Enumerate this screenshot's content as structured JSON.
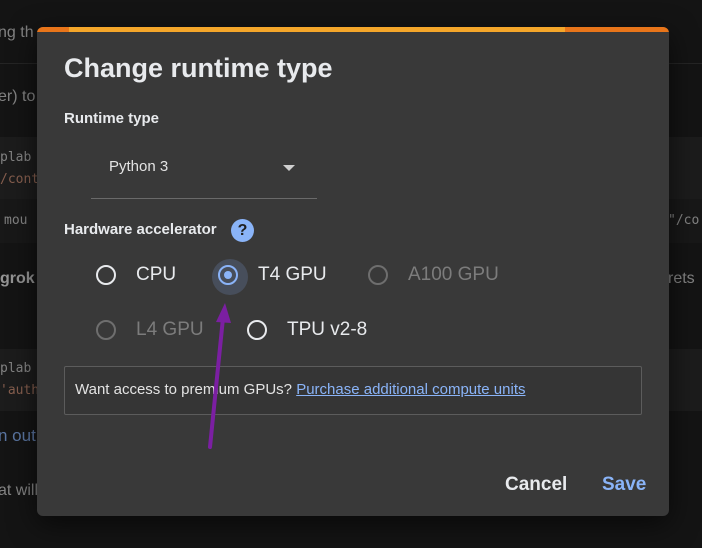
{
  "background": {
    "fragments": [
      "ng th",
      "er) to",
      "plab",
      "/cont",
      "mou",
      "\"/co",
      "grok",
      "rets",
      "plab",
      "'auth",
      "n out",
      "at will"
    ]
  },
  "dialog": {
    "title": "Change runtime type",
    "runtime_section_label": "Runtime type",
    "runtime_select_value": "Python 3",
    "hardware_section_label": "Hardware accelerator",
    "help_icon_glyph": "?",
    "accelerators": [
      {
        "label": "CPU",
        "state": "unselected"
      },
      {
        "label": "T4 GPU",
        "state": "selected"
      },
      {
        "label": "A100 GPU",
        "state": "disabled"
      },
      {
        "label": "L4 GPU",
        "state": "disabled"
      },
      {
        "label": "TPU v2-8",
        "state": "unselected"
      }
    ],
    "premium_prompt": "Want access to premium GPUs?",
    "premium_link": "Purchase additional compute units",
    "cancel_label": "Cancel",
    "save_label": "Save"
  },
  "colors": {
    "accent": "#8ab4f8",
    "progress_orange": "#e8751a",
    "progress_yellow": "#f4a62a",
    "annotation_arrow": "#7b1fa2"
  }
}
